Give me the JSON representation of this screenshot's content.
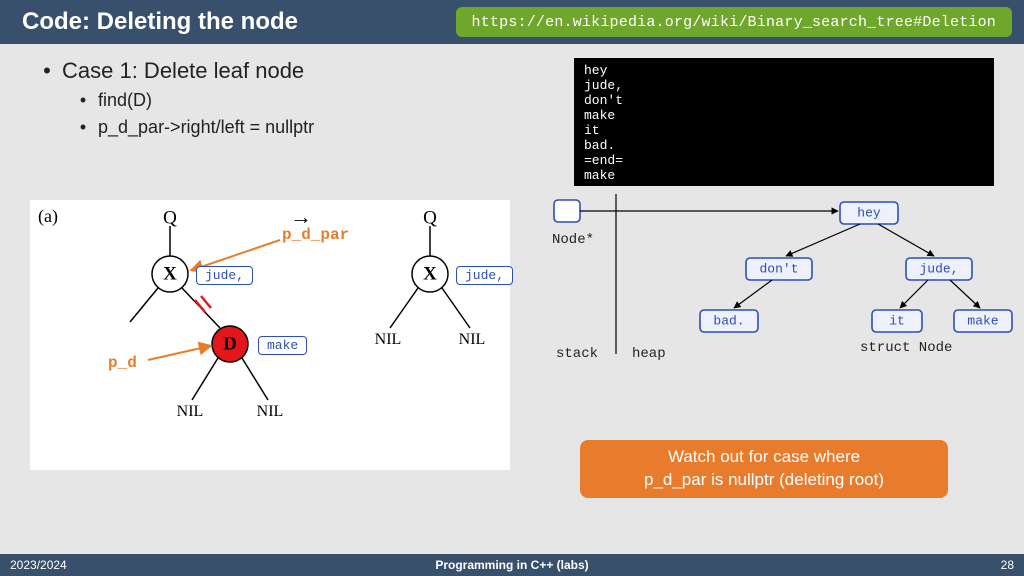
{
  "header": {
    "title": "Code: Deleting the node",
    "url": "https://en.wikipedia.org/wiki/Binary_search_tree#Deletion"
  },
  "bullets": {
    "case": "Case 1: Delete leaf node",
    "sub1": "find(D)",
    "sub2": "p_d_par->right/left = nullptr"
  },
  "terminal": {
    "text": "hey\njude,\ndon't\nmake\nit\nbad.\n=end=\nmake"
  },
  "figure": {
    "panel": "(a)",
    "left": {
      "Q": "Q",
      "X": "X",
      "D": "D",
      "NIL": "NIL",
      "tagX": "jude,",
      "tagD": "make"
    },
    "right": {
      "Q": "Q",
      "X": "X",
      "NIL": "NIL",
      "tagX": "jude,"
    },
    "ptrs": {
      "par": "p_d_par",
      "d": "p_d"
    },
    "arrow": "→"
  },
  "heap": {
    "stackptr": "Node*",
    "stack": "stack",
    "heaplbl": "heap",
    "structlbl": "struct Node",
    "nodes": {
      "root": "hey",
      "l": "don't",
      "r": "jude,",
      "ll": "bad.",
      "rl": "it",
      "rr": "make"
    }
  },
  "callout": {
    "line1": "Watch out for case where",
    "line2": "p_d_par is nullptr (deleting root)"
  },
  "footer": {
    "left": "2023/2024",
    "center": "Programming in C++ (labs)",
    "right": "28"
  }
}
